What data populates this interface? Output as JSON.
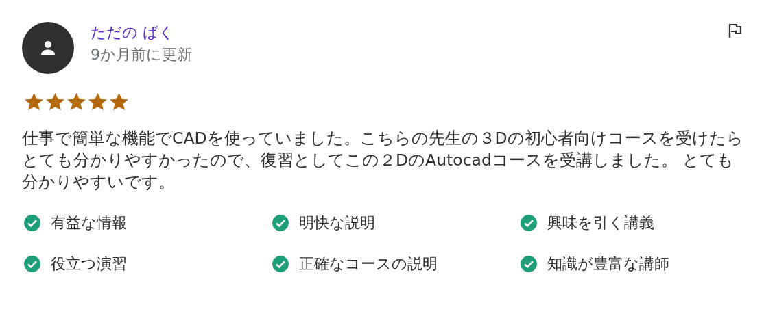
{
  "review": {
    "author": "ただの ばく",
    "time": "9か月前に更新",
    "stars": 5,
    "text": "仕事で簡単な機能でCADを使っていました。こちらの先生の３Dの初心者向けコースを受けたらとても分かりやすかったので、復習としてこの２DのAutocadコースを受講しました。 とても分かりやすいです。",
    "tags": [
      {
        "label": "有益な情報",
        "checked": true
      },
      {
        "label": "明快な説明",
        "checked": true
      },
      {
        "label": "興味を引く講義",
        "checked": true
      },
      {
        "label": "役立つ演習",
        "checked": true
      },
      {
        "label": "正確なコースの説明",
        "checked": true
      },
      {
        "label": "知識が豊富な講師",
        "checked": true
      }
    ]
  }
}
